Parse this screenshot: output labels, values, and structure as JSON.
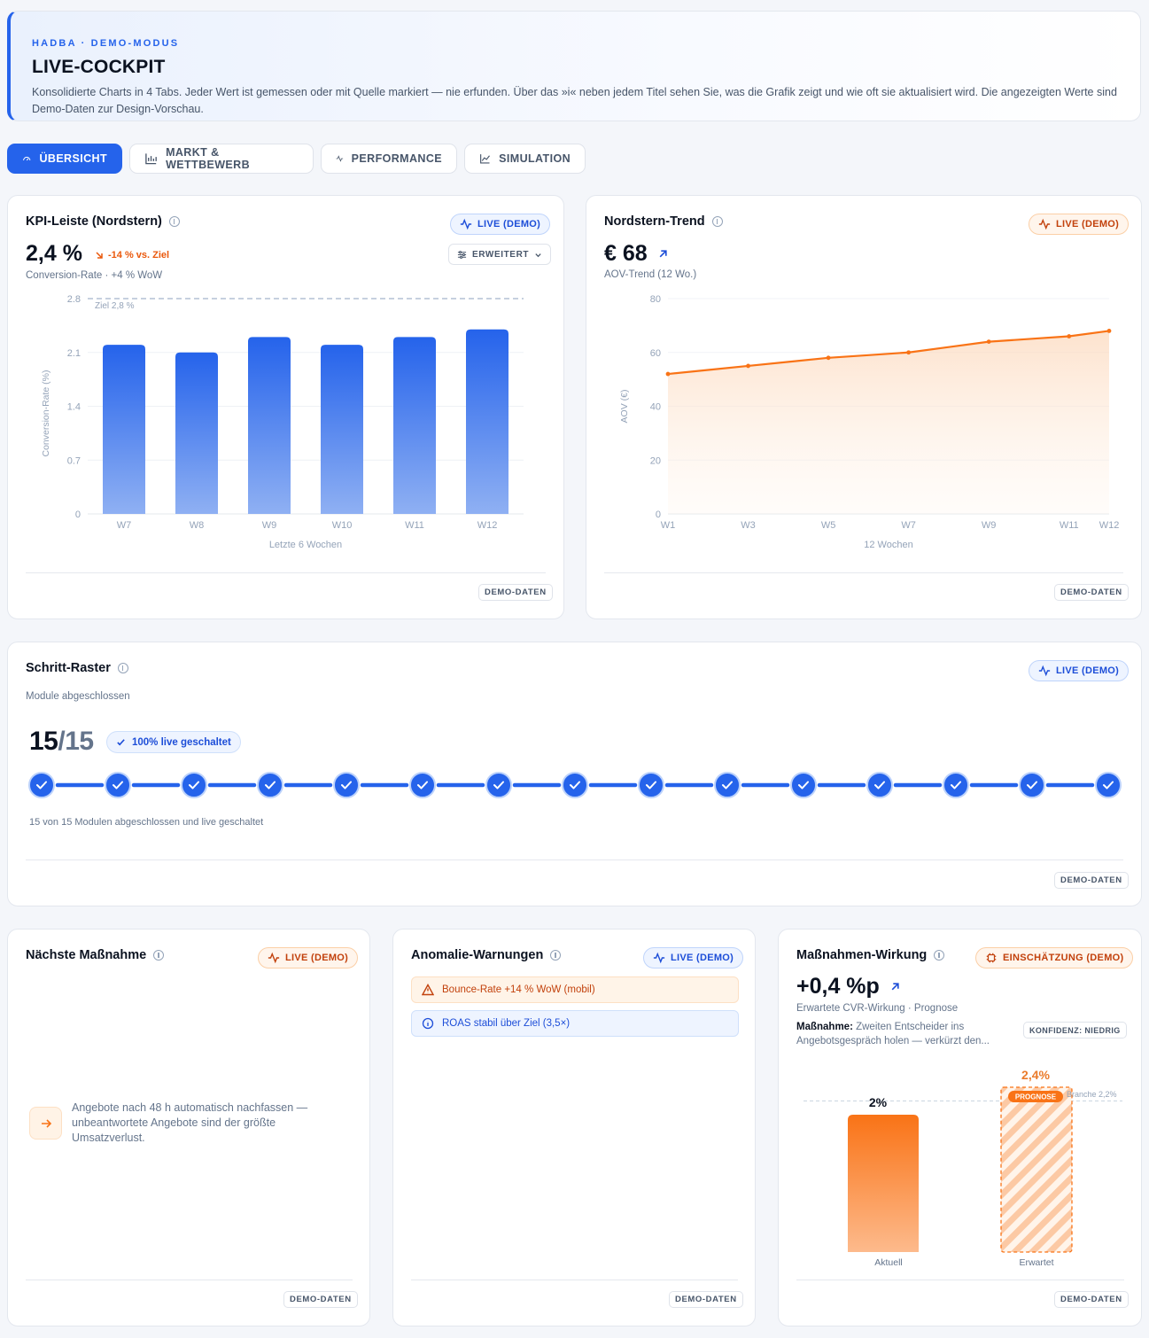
{
  "header": {
    "eyebrow": "HADBA · DEMO-MODUS",
    "title": "LIVE-COCKPIT",
    "description": "Konsolidierte Charts in 4 Tabs. Jeder Wert ist gemessen oder mit Quelle markiert — nie erfunden. Über das »i« neben jedem Titel sehen Sie, was die Grafik zeigt und wie oft sie aktualisiert wird. Die angezeigten Werte sind Demo-Daten zur Design-Vorschau."
  },
  "tabs": [
    {
      "label": "ÜBERSICHT",
      "active": true,
      "icon": "gauge-icon"
    },
    {
      "label": "MARKT & WETTBEWERB",
      "icon": "bar-chart-icon"
    },
    {
      "label": "PERFORMANCE",
      "icon": "pulse-icon"
    },
    {
      "label": "SIMULATION",
      "icon": "line-chart-icon"
    }
  ],
  "kpi": {
    "title": "KPI-Leiste (Nordstern)",
    "badge": "LIVE (DEMO)",
    "value": "2,4 %",
    "delta": "-14 % vs. Ziel",
    "subtitle": "Conversion-Rate · +4 % WoW",
    "mode_button": "ERWEITERT",
    "footer_tag": "DEMO-DATEN"
  },
  "trend": {
    "title": "Nordstern-Trend",
    "badge": "LIVE (DEMO)",
    "value": "€ 68",
    "subtitle": "AOV-Trend (12 Wo.)",
    "footer_tag": "DEMO-DATEN"
  },
  "steps": {
    "title": "Schritt-Raster",
    "badge": "LIVE (DEMO)",
    "subtitle": "Module abgeschlossen",
    "done": "15",
    "total": "/15",
    "status_badge": "100% live geschaltet",
    "caption": "15 von 15 Modulen abgeschlossen und live geschaltet",
    "completed": 15,
    "count": 15,
    "footer_tag": "DEMO-DATEN"
  },
  "next": {
    "title": "Nächste Maßnahme",
    "badge": "LIVE (DEMO)",
    "text": "Angebote nach 48 h automatisch nachfassen — unbeantwortete Angebote sind der größte Umsatzverlust.",
    "footer_tag": "DEMO-DATEN"
  },
  "anomaly": {
    "title": "Anomalie-Warnungen",
    "badge": "LIVE (DEMO)",
    "alerts": [
      {
        "text": "Bounce-Rate +14 % WoW (mobil)",
        "level": "warning"
      },
      {
        "text": "ROAS stabil über Ziel (3,5×)",
        "level": "info"
      }
    ],
    "footer_tag": "DEMO-DATEN"
  },
  "impact": {
    "title": "Maßnahmen-Wirkung",
    "badge": "EINSCHÄTZUNG (DEMO)",
    "value": "+0,4 %p",
    "subtitle": "Erwartete CVR-Wirkung · Prognose",
    "measure_label": "Maßnahme:",
    "measure_text": " Zweiten Entscheider ins Angebotsgespräch holen — verkürzt den...",
    "confidence": "KONFIDENZ: NIEDRIG",
    "footer_tag": "DEMO-DATEN"
  },
  "colors": {
    "accent": "#2563eb",
    "orange": "#f97316",
    "warning_bg": "#fff4e8",
    "info_bg": "#eef4ff"
  },
  "chart_data": [
    {
      "type": "bar",
      "categories": [
        "W7",
        "W8",
        "W9",
        "W10",
        "W11",
        "W12"
      ],
      "values": [
        2.2,
        2.1,
        2.3,
        2.2,
        2.3,
        2.4
      ],
      "ylabel": "Conversion-Rate (%)",
      "xlabel": "Letzte 6 Wochen",
      "yticks": [
        "0",
        "0.7",
        "1.4",
        "2.1",
        "2.8"
      ],
      "ylim": [
        0,
        2.8
      ],
      "target": 2.8,
      "target_label": "Ziel 2,8 %",
      "grid": true
    },
    {
      "type": "area",
      "x": [
        "W1",
        "W2",
        "W3",
        "W4",
        "W5",
        "W6",
        "W7",
        "W8",
        "W9",
        "W10",
        "W11",
        "W12"
      ],
      "xticks": [
        "W1",
        "W3",
        "W5",
        "W7",
        "W9",
        "W11",
        "W12"
      ],
      "values": [
        52,
        53.5,
        55,
        56.5,
        58,
        59,
        60,
        62,
        64,
        65,
        66,
        68
      ],
      "ylabel": "AOV (€)",
      "xlabel": "12 Wochen",
      "yticks": [
        "0",
        "20",
        "40",
        "60",
        "80"
      ],
      "ylim": [
        0,
        80
      ],
      "grid": true
    },
    {
      "type": "bar",
      "categories": [
        "Aktuell",
        "Erwartet"
      ],
      "values": [
        2.0,
        2.4
      ],
      "value_labels": [
        "2%",
        "2,4%"
      ],
      "forecast_label": "PROGNOSE",
      "reference_label": "Branche 2,2%",
      "reference": 2.2
    }
  ]
}
